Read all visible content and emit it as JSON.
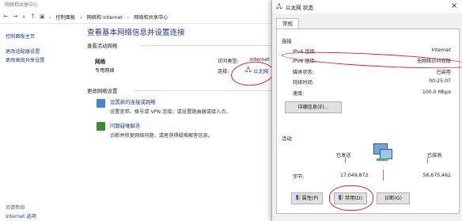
{
  "window": {
    "title": "网络和共享中心",
    "breadcrumb": [
      "控制面板",
      "网络和 Internet",
      "网络和共享中心"
    ]
  },
  "sidebar": {
    "items": [
      {
        "label": "控制面板主页"
      },
      {
        "label": "更改适配器设置"
      },
      {
        "label": "更改高级共享设置"
      }
    ],
    "see_also": {
      "title": "另请参阅",
      "items": [
        {
          "label": "Internet 选项"
        }
      ]
    }
  },
  "main": {
    "heading": "查看基本网络信息并设置连接",
    "active_networks_title": "查看活动网络",
    "network": {
      "name": "网络",
      "type": "专用网络",
      "access_type_label": "访问类型:",
      "access_type_value": "Internet",
      "connections_label": "连接:",
      "connection_link": "以太网"
    },
    "change_settings_title": "更改网络设置",
    "tasks": [
      {
        "title": "设置新的连接或网络",
        "desc": "设置宽带、拨号或 VPN 连接；或设置路由器或接入点。"
      },
      {
        "title": "问题疑难解答",
        "desc": "诊断并修复网络问题，或者获得疑难解答信息。"
      }
    ]
  },
  "dialog": {
    "title": "以太网 状态",
    "close_glyph": "×",
    "tab": "常规",
    "connection_section": "连接",
    "rows": [
      {
        "label": "IPv4 连接:",
        "value": "Internet"
      },
      {
        "label": "IPv6 连接:",
        "value": "无网络访问权限"
      },
      {
        "label": "媒体状态:",
        "value": "已启用"
      },
      {
        "label": "持续时间:",
        "value": "00:25:07"
      },
      {
        "label": "速度:",
        "value": "100.0 Mbps"
      }
    ],
    "details_button": "详细信息(E)...",
    "activity_section": "活动",
    "sent_label": "已发送",
    "received_label": "已接收",
    "bytes_label": "字节:",
    "bytes_sent": "17,049,872",
    "bytes_received": "56,675,462",
    "buttons": {
      "properties": "属性(P)",
      "disable": "禁用(D)",
      "diagnose": "诊断(G)"
    }
  },
  "colors": {
    "link": "#1a3c8f",
    "heading": "#1e3287",
    "annotation": "#e01f1f"
  }
}
